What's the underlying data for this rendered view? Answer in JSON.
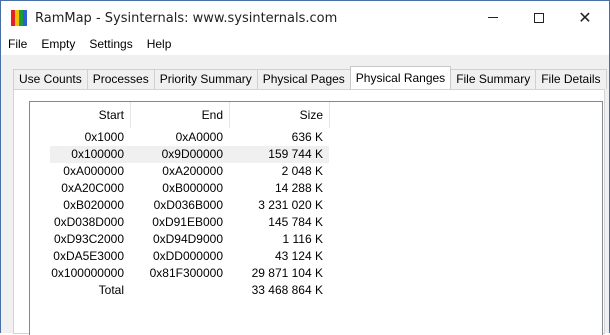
{
  "window": {
    "title": "RamMap - Sysinternals: www.sysinternals.com",
    "icon_colors": [
      "#e02424",
      "#f2c200",
      "#1a9b3a",
      "#2f5fd0"
    ]
  },
  "menu": {
    "items": [
      "File",
      "Empty",
      "Settings",
      "Help"
    ]
  },
  "tabs": [
    {
      "label": "Use Counts",
      "active": false
    },
    {
      "label": "Processes",
      "active": false
    },
    {
      "label": "Priority Summary",
      "active": false
    },
    {
      "label": "Physical Pages",
      "active": false
    },
    {
      "label": "Physical Ranges",
      "active": true
    },
    {
      "label": "File Summary",
      "active": false
    },
    {
      "label": "File Details",
      "active": false
    }
  ],
  "table": {
    "columns": [
      "Start",
      "End",
      "Size"
    ],
    "rows": [
      {
        "start": "0x1000",
        "end": "0xA0000",
        "size": "636 K",
        "selected": false
      },
      {
        "start": "0x100000",
        "end": "0x9D00000",
        "size": "159 744 K",
        "selected": true
      },
      {
        "start": "0xA000000",
        "end": "0xA200000",
        "size": "2 048 K",
        "selected": false
      },
      {
        "start": "0xA20C000",
        "end": "0xB000000",
        "size": "14 288 K",
        "selected": false
      },
      {
        "start": "0xB020000",
        "end": "0xD036B000",
        "size": "3 231 020 K",
        "selected": false
      },
      {
        "start": "0xD038D000",
        "end": "0xD91EB000",
        "size": "145 784 K",
        "selected": false
      },
      {
        "start": "0xD93C2000",
        "end": "0xD94D9000",
        "size": "1 116 K",
        "selected": false
      },
      {
        "start": "0xDA5E3000",
        "end": "0xDD000000",
        "size": "43 124 K",
        "selected": false
      },
      {
        "start": "0x100000000",
        "end": "0x81F300000",
        "size": "29 871 104 K",
        "selected": false
      },
      {
        "start": "Total",
        "end": "",
        "size": "33 468 864 K",
        "selected": false
      }
    ]
  },
  "caption_buttons": {
    "minimize": "minimize",
    "maximize": "maximize",
    "close": "✕"
  }
}
